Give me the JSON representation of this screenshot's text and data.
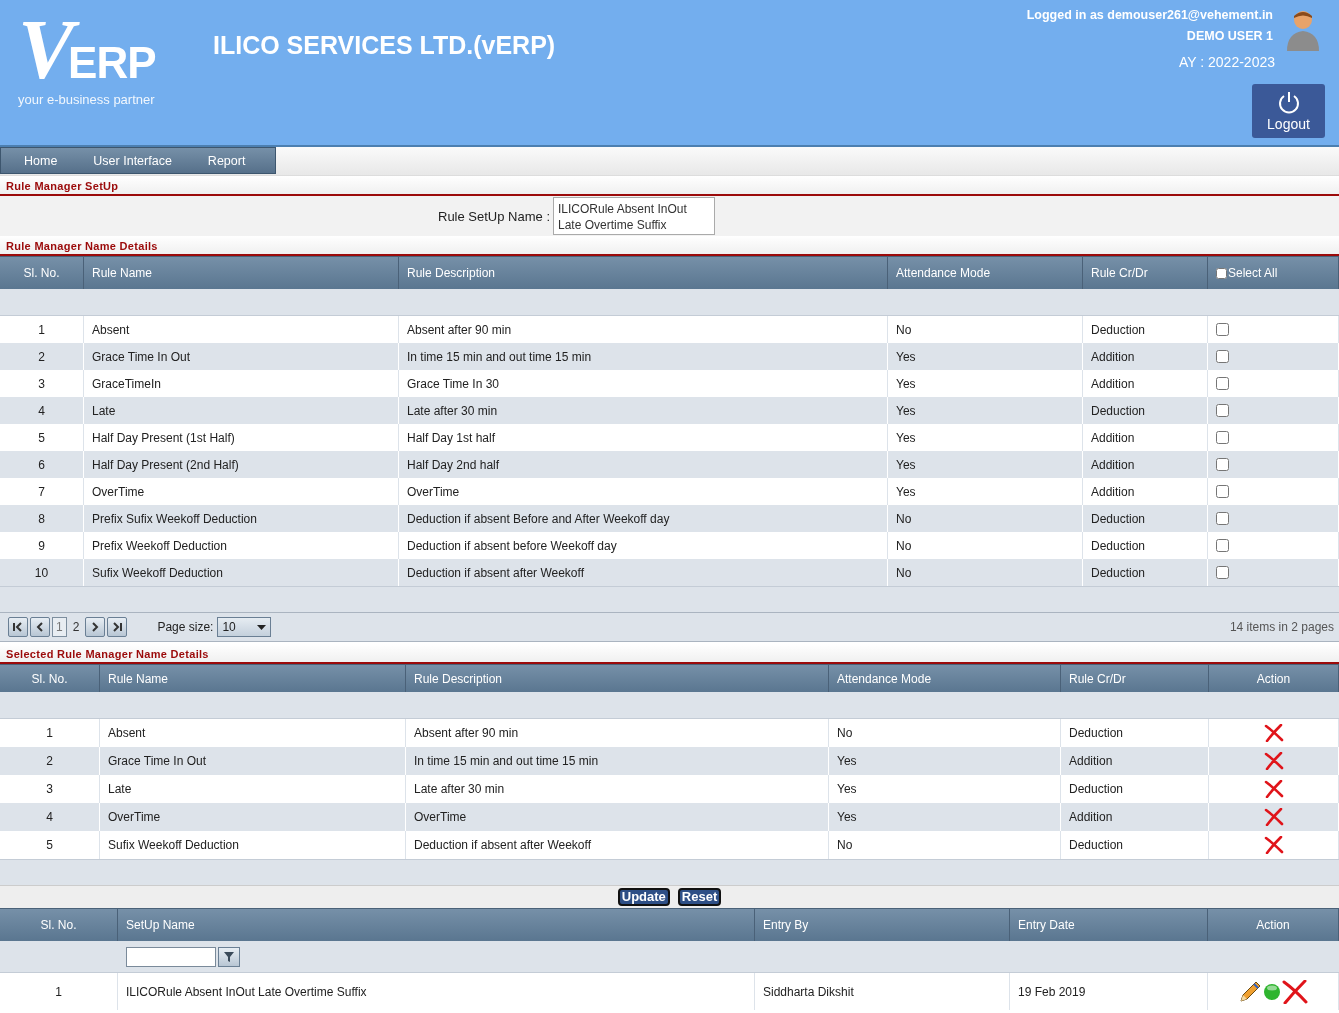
{
  "header": {
    "logo": {
      "mark": "V",
      "letters": "ERP",
      "tagline": "your e-business partner"
    },
    "title": "ILICO SERVICES LTD.(vERP)",
    "login_text": "Logged in as demouser261@vehement.in",
    "user_name": "DEMO USER 1",
    "academic_year": "AY : 2022-2023",
    "logout": "Logout"
  },
  "menu": [
    "Home",
    "User Interface",
    "Report"
  ],
  "setup_section": {
    "title": "Rule Manager SetUp",
    "label": "Rule SetUp Name :",
    "value": "ILICORule Absent InOut Late Overtime Suffix"
  },
  "rules_section": {
    "title": "Rule Manager Name Details",
    "columns": [
      "Sl. No.",
      "Rule Name",
      "Rule Description",
      "Attendance Mode",
      "Rule Cr/Dr"
    ],
    "select_all": {
      "label": "Select All",
      "checked": false
    },
    "rows": [
      {
        "sl": "1",
        "name": "Absent",
        "description": "Absent after 90 min",
        "mode": "No",
        "crdr": "Deduction",
        "checked": false
      },
      {
        "sl": "2",
        "name": "Grace Time In Out",
        "description": "In time 15 min and out time 15 min",
        "mode": "Yes",
        "crdr": "Addition",
        "checked": false
      },
      {
        "sl": "3",
        "name": "GraceTimeIn",
        "description": "Grace Time In 30",
        "mode": "Yes",
        "crdr": "Addition",
        "checked": false
      },
      {
        "sl": "4",
        "name": "Late",
        "description": "Late after 30 min",
        "mode": "Yes",
        "crdr": "Deduction",
        "checked": false
      },
      {
        "sl": "5",
        "name": "Half Day Present (1st Half)",
        "description": "Half Day 1st half",
        "mode": "Yes",
        "crdr": "Addition",
        "checked": false
      },
      {
        "sl": "6",
        "name": "Half Day Present (2nd Half)",
        "description": "Half Day 2nd half",
        "mode": "Yes",
        "crdr": "Addition",
        "checked": false
      },
      {
        "sl": "7",
        "name": "OverTime",
        "description": "OverTime",
        "mode": "Yes",
        "crdr": "Addition",
        "checked": false
      },
      {
        "sl": "8",
        "name": "Prefix Sufix Weekoff Deduction",
        "description": "Deduction if absent Before and After Weekoff day",
        "mode": "No",
        "crdr": "Deduction",
        "checked": false
      },
      {
        "sl": "9",
        "name": "Prefix Weekoff Deduction",
        "description": "Deduction if absent before Weekoff day",
        "mode": "No",
        "crdr": "Deduction",
        "checked": false
      },
      {
        "sl": "10",
        "name": "Sufix Weekoff Deduction",
        "description": "Deduction if absent after Weekoff",
        "mode": "No",
        "crdr": "Deduction",
        "checked": false
      }
    ],
    "pager": {
      "pages": [
        {
          "label": "1",
          "selected": true
        },
        {
          "label": "2",
          "selected": false
        }
      ],
      "page_size_label": "Page size:",
      "page_size": "10",
      "summary": "14 items in 2 pages"
    }
  },
  "selected_section": {
    "title": "Selected Rule Manager Name Details",
    "columns": [
      "Sl. No.",
      "Rule Name",
      "Rule Description",
      "Attendance Mode",
      "Rule Cr/Dr",
      "Action"
    ],
    "rows": [
      {
        "sl": "1",
        "name": "Absent",
        "description": "Absent after 90 min",
        "mode": "No",
        "crdr": "Deduction"
      },
      {
        "sl": "2",
        "name": "Grace Time In Out",
        "description": "In time 15 min and out time 15 min",
        "mode": "Yes",
        "crdr": "Addition"
      },
      {
        "sl": "3",
        "name": "Late",
        "description": "Late after 30 min",
        "mode": "Yes",
        "crdr": "Deduction"
      },
      {
        "sl": "4",
        "name": "OverTime",
        "description": "OverTime",
        "mode": "Yes",
        "crdr": "Addition"
      },
      {
        "sl": "5",
        "name": "Sufix Weekoff Deduction",
        "description": "Deduction if absent after Weekoff",
        "mode": "No",
        "crdr": "Deduction"
      }
    ]
  },
  "buttons": [
    "Update",
    "Reset"
  ],
  "setups_table": {
    "columns": [
      "Sl. No.",
      "SetUp Name",
      "Entry By",
      "Entry Date",
      "Action"
    ],
    "rows": [
      {
        "sl": "1",
        "name": "ILICORule Absent InOut Late Overtime Suffix",
        "entry_by": "Siddharta Dikshit",
        "entry_date": "19 Feb 2019",
        "active": true
      }
    ]
  }
}
